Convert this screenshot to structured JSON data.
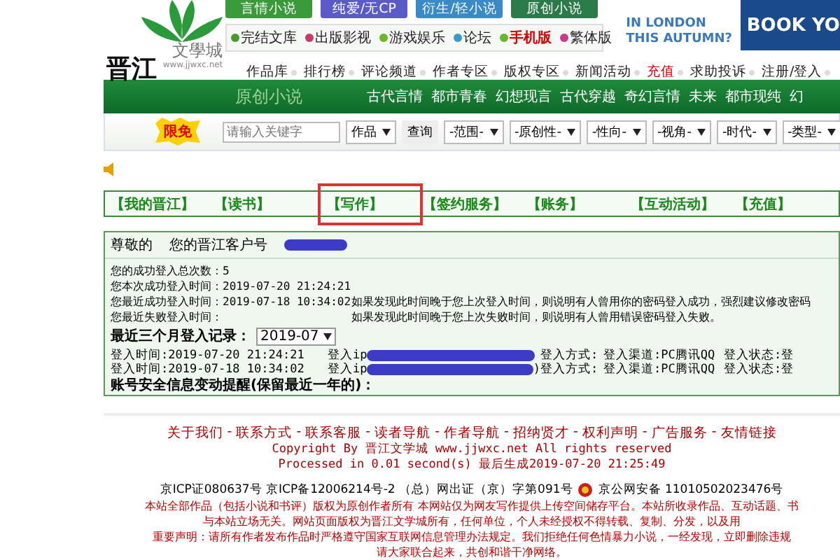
{
  "logo": {
    "name": "文學城",
    "url": "www.jjwxc.net",
    "calligraphy": "晋江"
  },
  "channel_buttons": [
    {
      "label": "言情小说",
      "color": "#3a9a3a"
    },
    {
      "label": "纯爱/无CP",
      "color": "#5a5ac8"
    },
    {
      "label": "衍生/轻小说",
      "color": "#3a8ac8"
    },
    {
      "label": "原创小说",
      "color": "#2a7a4a"
    }
  ],
  "quick_links": [
    {
      "label": "完结文库",
      "color": "#4a9a2a",
      "highlight": false
    },
    {
      "label": "出版影视",
      "color": "#c83a6a",
      "highlight": false
    },
    {
      "label": "游戏娱乐",
      "color": "#6ab82a",
      "highlight": false
    },
    {
      "label": "论坛",
      "color": "#3a9ac8",
      "highlight": false
    },
    {
      "label": "手机版",
      "color": "#6ab82a",
      "highlight": true
    },
    {
      "label": "繁体版",
      "color": "#c83a8a",
      "highlight": false
    }
  ],
  "ad": {
    "lines": [
      "IN LONDON",
      "THIS AUTUMN?"
    ],
    "cta": "BOOK YO"
  },
  "main_nav": [
    {
      "label": "作品库",
      "highlight": false
    },
    {
      "label": "排行榜",
      "highlight": false
    },
    {
      "label": "评论频道",
      "highlight": false
    },
    {
      "label": "作者专区",
      "highlight": false
    },
    {
      "label": "版权专区",
      "highlight": false
    },
    {
      "label": "新闻活动",
      "highlight": false
    },
    {
      "label": "充值",
      "highlight": true
    },
    {
      "label": "求助投诉",
      "highlight": false
    },
    {
      "label": "注册/登入",
      "highlight": false
    }
  ],
  "channel_bar": {
    "title": "原创小说",
    "genres": [
      "古代言情",
      "都市青春",
      "幻想现言",
      "古代穿越",
      "奇幻言情",
      "未来",
      "都市现纯",
      "幻"
    ]
  },
  "search": {
    "badge": "限免",
    "placeholder": "请输入关键字",
    "type_select": "作品",
    "button": "查询",
    "filters": [
      "-范围-",
      "-原创性-",
      "-性向-",
      "-视角-",
      "-时代-",
      "-类型-"
    ]
  },
  "tabs": [
    {
      "label": "【我的晋江】",
      "selected": false
    },
    {
      "label": "【读书】",
      "selected": false
    },
    {
      "label": "【写作】",
      "selected": true
    },
    {
      "label": "【签约服务】",
      "selected": false
    },
    {
      "label": "【账务】",
      "selected": false
    },
    {
      "label": "【互动活动】",
      "selected": false
    },
    {
      "label": "【充值】",
      "selected": false
    }
  ],
  "account": {
    "greeting": "尊敬的",
    "customer_label": "您的晋江客户号",
    "stats": [
      {
        "label": "您的成功登入总次数：5"
      },
      {
        "label": "您本次成功登入时间：2019-07-20 21:24:21"
      },
      {
        "label": "您最近成功登入时间：2019-07-18 10:34:02",
        "note": "如果发现此时间晚于您上次登入时间，则说明有人曾用你的密码登入成功，强烈建议修改密码"
      },
      {
        "label": "您最近失败登入时间：",
        "note": "如果发现此时间晚于您上次失败时间，则说明有人曾用错误密码登入失败。"
      }
    ],
    "history_label": "最近三个月登入记录：",
    "month": "2019-07",
    "logins": [
      {
        "time": "登入时间:2019-07-20 21:24:21",
        "ip_label": "登入ip",
        "method": "登入方式:",
        "channel": "登入渠道:PC腾讯QQ",
        "status": "登入状态:登"
      },
      {
        "time": "登入时间:2019-07-18 10:34:02",
        "ip_label": "登入ip",
        "ip_suffix": ")",
        "method": "登入方式:",
        "channel": "登入渠道:PC腾讯QQ",
        "status": "登入状态:登"
      }
    ],
    "security_label": "账号安全信息变动提醒(保留最近一年的)："
  },
  "footer": {
    "links": [
      "关于我们",
      "联系方式",
      "联系客服",
      "读者导航",
      "作者导航",
      "招纳贤才",
      "权利声明",
      "广告服务",
      "友情链接"
    ],
    "separator": "-",
    "copyright": "Copyright By 晋江文学城 www.jjwxc.net All rights reserved",
    "processed": "Processed in 0.01 second(s) 最后生成2019-07-20 21:25:49",
    "icp": "京ICP证080637号 京ICP备12006214号-2 （总）网出证（京）字第091号",
    "police": "京公网安备 11010502023476号",
    "notice": [
      "本站全部作品（包括小说和书评）版权为原创作者所有 本网站仅为网友写作提供上传空间储存平台。本站所收录作品、互动话题、书",
      "与本站立场无关。网站页面版权为晋江文学城所有，任何单位，个人未经授权不得转载、复制、分发，以及用",
      "重要声明：请所有作者发布作品时严格遵守国家互联网信息管理办法规定。我们拒绝任何色情暴力小说，一经发现，立即删除违规",
      "请大家联合起来，共创和谐干净网络。"
    ]
  }
}
